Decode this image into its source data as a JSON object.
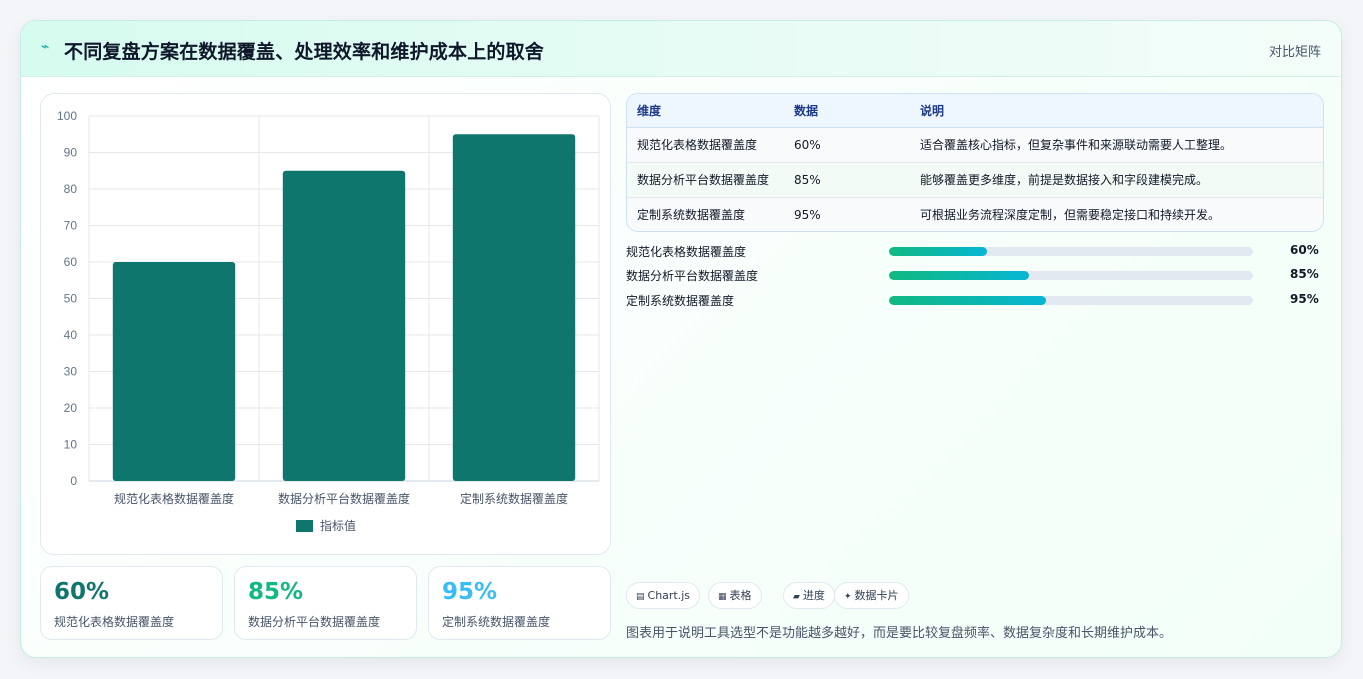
{
  "header": {
    "icon": "spark-icon",
    "title": "不同复盘方案在数据覆盖、处理效率和维护成本上的取舍",
    "tag": "对比矩阵"
  },
  "chart_data": {
    "type": "bar",
    "categories": [
      "规范化表格数据覆盖度",
      "数据分析平台数据覆盖度",
      "定制系统数据覆盖度"
    ],
    "series": [
      {
        "name": "指标值",
        "values": [
          60,
          85,
          95
        ],
        "color": "#0f766e"
      }
    ],
    "ylim": [
      0,
      100
    ],
    "yticks": [
      0,
      10,
      20,
      30,
      40,
      50,
      60,
      70,
      80,
      90,
      100
    ],
    "grid": true,
    "legend": "bottom"
  },
  "stats": [
    {
      "value": "60%",
      "label": "规范化表格数据覆盖度",
      "color": "#0f766e"
    },
    {
      "value": "85%",
      "label": "数据分析平台数据覆盖度",
      "color": "#10b981"
    },
    {
      "value": "95%",
      "label": "定制系统数据覆盖度",
      "color": "#38bdf8"
    }
  ],
  "table": {
    "headers": [
      "维度",
      "数据",
      "说明"
    ],
    "rows": [
      [
        "规范化表格数据覆盖度",
        "60%",
        "适合覆盖核心指标，但复杂事件和来源联动需要人工整理。"
      ],
      [
        "数据分析平台数据覆盖度",
        "85%",
        "能够覆盖更多维度，前提是数据接入和字段建模完成。"
      ],
      [
        "定制系统数据覆盖度",
        "95%",
        "可根据业务流程深度定制，但需要稳定接口和持续开发。"
      ]
    ]
  },
  "progress": [
    {
      "label": "规范化表格数据覆盖度",
      "value_text": "60%",
      "fill": 0.27
    },
    {
      "label": "数据分析平台数据覆盖度",
      "value_text": "85%",
      "fill": 0.385
    },
    {
      "label": "定制系统数据覆盖度",
      "value_text": "95%",
      "fill": 0.43
    }
  ],
  "chips": [
    {
      "icon": "chart-icon",
      "glyph": "▤",
      "label": "Chart.js"
    },
    {
      "icon": "table-icon",
      "glyph": "▦",
      "label": "表格"
    },
    {
      "icon": "progress-icon",
      "glyph": "▰",
      "label": "进度"
    },
    {
      "icon": "card-icon",
      "glyph": "✦",
      "label": "数据卡片"
    }
  ],
  "note": "图表用于说明工具选型不是功能越多越好，而是要比较复盘频率、数据复杂度和长期维护成本。"
}
